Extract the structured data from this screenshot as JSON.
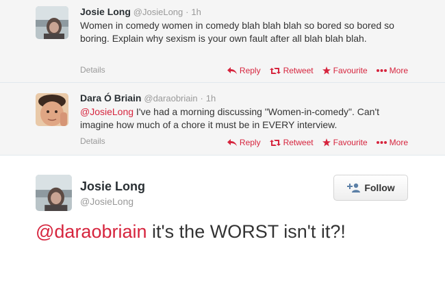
{
  "tweets": [
    {
      "fullname": "Josie Long",
      "screen_name": "@JosieLong",
      "dot": "·",
      "time": "1h",
      "mention": "",
      "text": "Women in comedy women in comedy blah blah blah so bored so bored so boring. Explain why sexism is your own fault after all blah blah blah.",
      "details_label": "Details"
    },
    {
      "fullname": "Dara Ó Briain",
      "screen_name": "@daraobriain",
      "dot": "·",
      "time": "1h",
      "mention": "@JosieLong",
      "text": " I've had a morning discussing \"Women-in-comedy\". Can't imagine how much of a chore it must be in EVERY interview.",
      "details_label": "Details"
    }
  ],
  "actions": {
    "reply": "Reply",
    "retweet": "Retweet",
    "favourite": "Favourite",
    "more": "More"
  },
  "main_tweet": {
    "fullname": "Josie Long",
    "screen_name": "@JosieLong",
    "follow_label": "Follow",
    "mention": "@daraobriain",
    "text": " it's the WORST isn't it?!"
  },
  "colors": {
    "link": "#d6243d",
    "muted": "#999999",
    "reply_bg": "#f5f5f5"
  },
  "icons": [
    "reply-icon",
    "retweet-icon",
    "favourite-icon",
    "more-icon",
    "follow-user-icon"
  ]
}
